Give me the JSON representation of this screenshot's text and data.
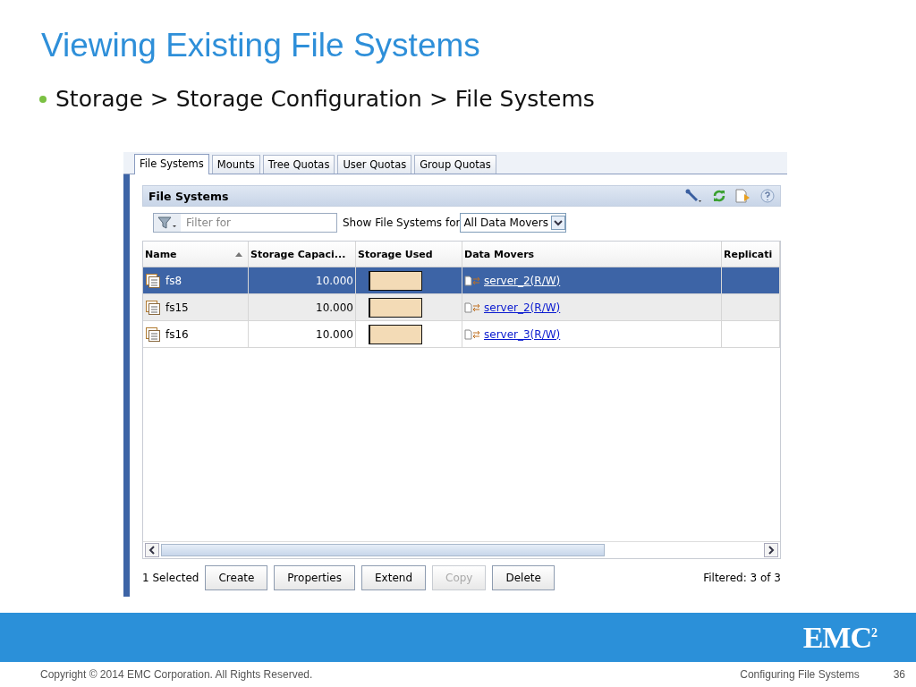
{
  "slide": {
    "title": "Viewing Existing File Systems",
    "bullet": "Storage > Storage Configuration > File Systems"
  },
  "tabs": [
    {
      "label": "File Systems",
      "selected": true
    },
    {
      "label": "Mounts",
      "selected": false
    },
    {
      "label": "Tree Quotas",
      "selected": false
    },
    {
      "label": "User Quotas",
      "selected": false
    },
    {
      "label": "Group Quotas",
      "selected": false
    }
  ],
  "panel": {
    "title": "File Systems"
  },
  "filter": {
    "placeholder": "Filter for",
    "show_label": "Show File Systems for",
    "data_movers": "All Data Movers"
  },
  "table": {
    "columns": [
      {
        "label": "Name",
        "sorted": true
      },
      {
        "label": "Storage Capaci...",
        "sorted": false
      },
      {
        "label": "Storage Used",
        "sorted": false
      },
      {
        "label": "Data Movers",
        "sorted": false
      },
      {
        "label": "Replicati",
        "sorted": false
      }
    ],
    "rows": [
      {
        "name": "fs8",
        "capacity": "10.000",
        "level": 0.02,
        "data_mover": "server_2(R/W)",
        "selected": true
      },
      {
        "name": "fs15",
        "capacity": "10.000",
        "level": 0.02,
        "data_mover": "server_2(R/W)",
        "selected": false
      },
      {
        "name": "fs16",
        "capacity": "10.000",
        "level": 0.02,
        "data_mover": "server_3(R/W)",
        "selected": false
      }
    ]
  },
  "status": {
    "selection": "1 Selected",
    "filtered": "Filtered: 3 of 3"
  },
  "buttons": [
    {
      "label": "Create",
      "disabled": false
    },
    {
      "label": "Properties",
      "disabled": false
    },
    {
      "label": "Extend",
      "disabled": false
    },
    {
      "label": "Copy",
      "disabled": true
    },
    {
      "label": "Delete",
      "disabled": false
    }
  ],
  "footer": {
    "logo": "EMC$^{2}$",
    "copyright": "Copyright © 2014 EMC Corporation. All Rights Reserved.",
    "section": "Configuring File Systems",
    "page": "36"
  }
}
